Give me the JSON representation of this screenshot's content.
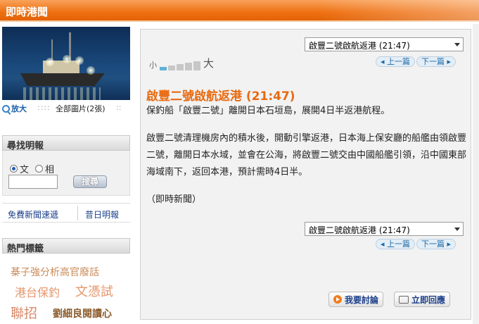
{
  "header": {
    "title": "即時港聞"
  },
  "left": {
    "photo_zoom": "放大",
    "photo_all": "全部圖片(2張)",
    "search": {
      "title": "尋找明報",
      "option_text": "文",
      "option_photo": "相",
      "button": "搜尋"
    },
    "links": {
      "free_news": "免費新聞速遞",
      "past_paper": "昔日明報"
    },
    "hot_tags": {
      "title": "熱門標籤",
      "tags": [
        "棊子強分析高官廢話",
        "港台保釣",
        "文憑試",
        "聯招",
        "劉細良閱讀心"
      ]
    }
  },
  "article": {
    "select_value": "啟豐二號啟航返港 (21:47)",
    "font_small": "小",
    "font_big": "大",
    "font_level": 0.2,
    "prev": "上一篇",
    "next": "下一篇",
    "headline": "啟豐二號啟航返港 (21:47)",
    "para1": "保釣船「啟豐二號」離開日本石垣島，展開4日半返港航程。",
    "para2": "啟豐二號清理機房內的積水後，開動引擎返港，日本海上保安廳的船艦由領啟豐二號，離開日本水域，並會在公海，將啟豐二號交由中國船艦引領，沿中國東部海域南下，返回本港，預計需時4日半。",
    "source": "（即時新聞）",
    "discuss": "我要討論",
    "reply": "立即回應"
  }
}
